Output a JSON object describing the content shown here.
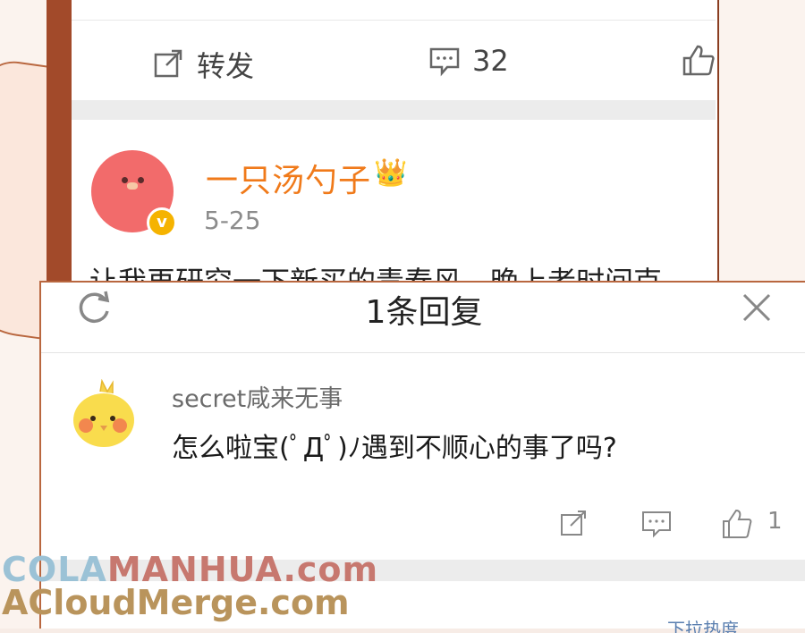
{
  "feed": {
    "repost_label": "转发",
    "comment_count": "32",
    "post": {
      "username": "一只汤勺子",
      "crown_glyph": "👑",
      "verified_glyph": "v",
      "date": "5-25",
      "text": "让我再研究一下新买的青春风，晚上者时间克"
    }
  },
  "popup": {
    "title": "1条回复",
    "reply": {
      "username": "secret咸来无事",
      "text": "怎么啦宝(ﾟДﾟ)ﾉ遇到不顺心的事了吗?",
      "like_count": "1"
    },
    "bottom_hint": "下拉热度"
  },
  "watermark": {
    "line1_a": "COLA",
    "line1_b": "MANHUA.com",
    "line2": "ACloudMerge.com"
  },
  "colors": {
    "accent_orange": "#f07a1a",
    "frame_brown": "#a24a2a",
    "verified_gold": "#f5b300"
  }
}
